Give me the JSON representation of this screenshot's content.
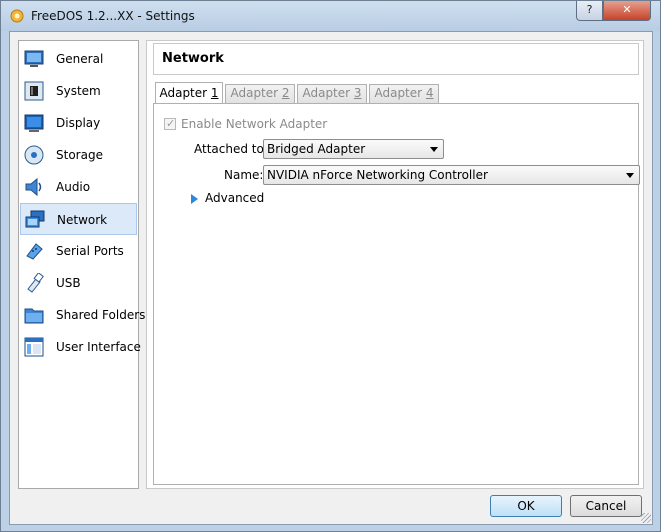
{
  "window": {
    "title": "FreeDOS 1.2...XX - Settings",
    "help_label": "?",
    "close_label": "✕"
  },
  "sidebar": {
    "items": [
      {
        "label": "General",
        "icon": "general-icon",
        "selected": false
      },
      {
        "label": "System",
        "icon": "system-icon",
        "selected": false
      },
      {
        "label": "Display",
        "icon": "display-icon",
        "selected": false
      },
      {
        "label": "Storage",
        "icon": "storage-icon",
        "selected": false
      },
      {
        "label": "Audio",
        "icon": "audio-icon",
        "selected": false
      },
      {
        "label": "Network",
        "icon": "network-icon",
        "selected": true
      },
      {
        "label": "Serial Ports",
        "icon": "serial-ports-icon",
        "selected": false
      },
      {
        "label": "USB",
        "icon": "usb-icon",
        "selected": false
      },
      {
        "label": "Shared Folders",
        "icon": "shared-folders-icon",
        "selected": false
      },
      {
        "label": "User Interface",
        "icon": "user-interface-icon",
        "selected": false
      }
    ]
  },
  "main": {
    "section_title": "Network",
    "tabs": [
      {
        "label_text": "Adapter ",
        "label_key": "1",
        "active": true
      },
      {
        "label_text": "Adapter ",
        "label_key": "2",
        "active": false
      },
      {
        "label_text": "Adapter ",
        "label_key": "3",
        "active": false
      },
      {
        "label_text": "Adapter ",
        "label_key": "4",
        "active": false
      }
    ],
    "enable_adapter": {
      "label": "Enable Network Adapter",
      "checked": true,
      "enabled": false
    },
    "attached_to": {
      "label": "Attached to:",
      "value": "Bridged Adapter"
    },
    "name": {
      "label": "Name:",
      "value": "NVIDIA nForce Networking Controller"
    },
    "advanced": {
      "label": "Advanced"
    }
  },
  "buttons": {
    "ok": "OK",
    "cancel": "Cancel"
  },
  "colors": {
    "accent": "#2e88d8",
    "selection": "#dbe9f8",
    "window_frame": "#bcd0e6"
  }
}
